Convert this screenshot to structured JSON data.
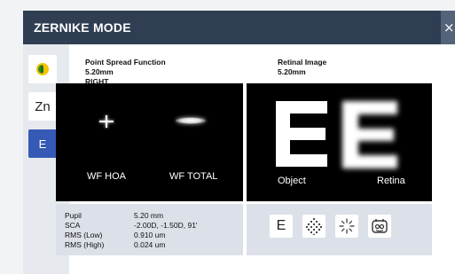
{
  "window": {
    "title": "ZERNIKE MODE",
    "close_glyph": "×"
  },
  "sidebar": {
    "items": [
      {
        "name": "eye-mode-icon",
        "label": ""
      },
      {
        "name": "zn",
        "label": "Zn"
      },
      {
        "name": "e",
        "label": "E",
        "active": true
      }
    ]
  },
  "psf": {
    "title": "Point Spread Function",
    "size": "5.20mm",
    "eye": "RIGHT",
    "hoa_label": "WF HOA",
    "total_label": "WF TOTAL"
  },
  "retinal": {
    "title": "Retinal Image",
    "size": "5.20mm",
    "object_label": "Object",
    "retina_label": "Retina"
  },
  "info": {
    "rows": [
      {
        "key": "Pupil",
        "value": "5.20 mm"
      },
      {
        "key": "SCA",
        "value": "-2.00D, -1.50D, 91'"
      },
      {
        "key": "RMS (Low)",
        "value": "0.910 um"
      },
      {
        "key": "RMS (High)",
        "value": "0.024 um"
      }
    ]
  },
  "tools": {
    "e_label": "E",
    "icons": [
      "e-chart-icon",
      "dot-grid-icon",
      "starburst-icon",
      "eye-pattern-icon"
    ]
  },
  "colors": {
    "titlebar": "#2f3e52",
    "active": "#3559b5",
    "panel": "#dce0e8",
    "sidebar": "#e6e9ee"
  }
}
